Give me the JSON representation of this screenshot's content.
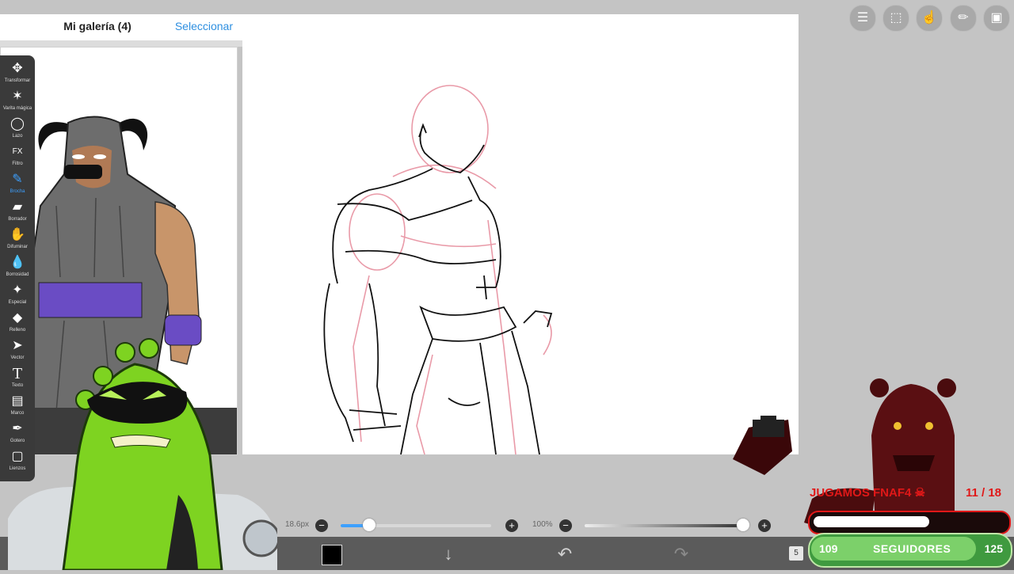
{
  "gallery": {
    "title": "Mi galería (4)",
    "select": "Seleccionar"
  },
  "toolbar": {
    "tools": [
      {
        "label": "Transformar",
        "icon": "move-icon",
        "glyph": "✥"
      },
      {
        "label": "Varita mágica",
        "icon": "magic-wand-icon",
        "glyph": "✶"
      },
      {
        "label": "Lazo",
        "icon": "lasso-icon",
        "glyph": "◯"
      },
      {
        "label": "Filtro",
        "icon": "fx-icon",
        "glyph": "FX"
      },
      {
        "label": "Brocha",
        "icon": "brush-icon",
        "glyph": "✎",
        "active": true
      },
      {
        "label": "Borrador",
        "icon": "eraser-icon",
        "glyph": "▰"
      },
      {
        "label": "Difuminar",
        "icon": "smudge-icon",
        "glyph": "✋"
      },
      {
        "label": "Borrosidad",
        "icon": "blur-icon",
        "glyph": "💧"
      },
      {
        "label": "Especial",
        "icon": "special-icon",
        "glyph": "✦"
      },
      {
        "label": "Relleno",
        "icon": "fill-icon",
        "glyph": "◆"
      },
      {
        "label": "Vector",
        "icon": "vector-icon",
        "glyph": "➤"
      },
      {
        "label": "Texto",
        "icon": "text-icon",
        "glyph": "T"
      },
      {
        "label": "Marco",
        "icon": "frame-icon",
        "glyph": "▤"
      },
      {
        "label": "Gotero",
        "icon": "eyedropper-icon",
        "glyph": "✒"
      },
      {
        "label": "Lienzos",
        "icon": "canvas-icon",
        "glyph": "▢"
      }
    ]
  },
  "top_icons": [
    "settings-toggle-icon",
    "selection-icon",
    "touch-icon",
    "ruler-icon",
    "image-icon"
  ],
  "brush": {
    "size_label": "18.6px",
    "size_fraction": 0.19,
    "opacity_label": "100%",
    "opacity_fraction": 1.0
  },
  "colors": {
    "current": "#000000",
    "accent": "#3da0ff",
    "goal_green": "#3f9a3f",
    "stream_red": "#e01818"
  },
  "bottom": {
    "layers_count": "5"
  },
  "stream": {
    "title": "JUGAMOS FNAF4 ☠",
    "count": "11 / 18",
    "count_fraction": 0.61
  },
  "goal": {
    "start": "109",
    "label": "SEGUIDORES",
    "end": "125",
    "fraction": 0.83
  }
}
